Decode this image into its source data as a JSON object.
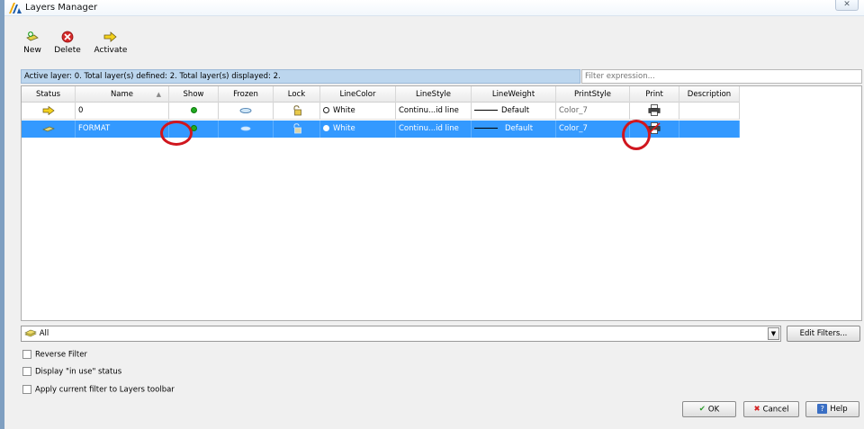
{
  "window": {
    "title": "Layers Manager",
    "close_glyph": "✕"
  },
  "toolbar": {
    "new_label": "New",
    "delete_label": "Delete",
    "activate_label": "Activate"
  },
  "status_text": "Active layer: 0. Total layer(s) defined: 2. Total layer(s) displayed: 2.",
  "filter": {
    "placeholder": "Filter expression..."
  },
  "columns": [
    "Status",
    "Name",
    "Show",
    "Frozen",
    "Lock",
    "LineColor",
    "LineStyle",
    "LineWeight",
    "PrintStyle",
    "Print",
    "Description"
  ],
  "layers": [
    {
      "status_icon": "activate-arrow-icon",
      "name": "0",
      "show": "on",
      "frozen": "thawed",
      "lock": "unlocked",
      "linecolor": "White",
      "linestyle": "Continu...id line",
      "lineweight": "Default",
      "printstyle": "Color_7",
      "print": "printer-icon",
      "description": "",
      "selected": false
    },
    {
      "status_icon": "layer-icon",
      "name": "FORMAT",
      "show": "on",
      "frozen": "thawed",
      "lock": "unlocked",
      "linecolor": "White",
      "linestyle": "Continu...id line",
      "lineweight": "Default",
      "printstyle": "Color_7",
      "print": "printer-no-icon",
      "description": "",
      "selected": true
    }
  ],
  "layer_filter": {
    "selected": "All"
  },
  "buttons": {
    "edit_filters": "Edit Filters...",
    "ok": "OK",
    "cancel": "Cancel",
    "help": "Help"
  },
  "options": {
    "reverse_filter": "Reverse Filter",
    "in_use_status": "Display \"in use\" status",
    "apply_toolbar": "Apply current filter to Layers toolbar"
  },
  "colors": {
    "selection": "#3399ff",
    "status_bar": "#bcd6ee",
    "annotation_circle": "#d0161e"
  }
}
